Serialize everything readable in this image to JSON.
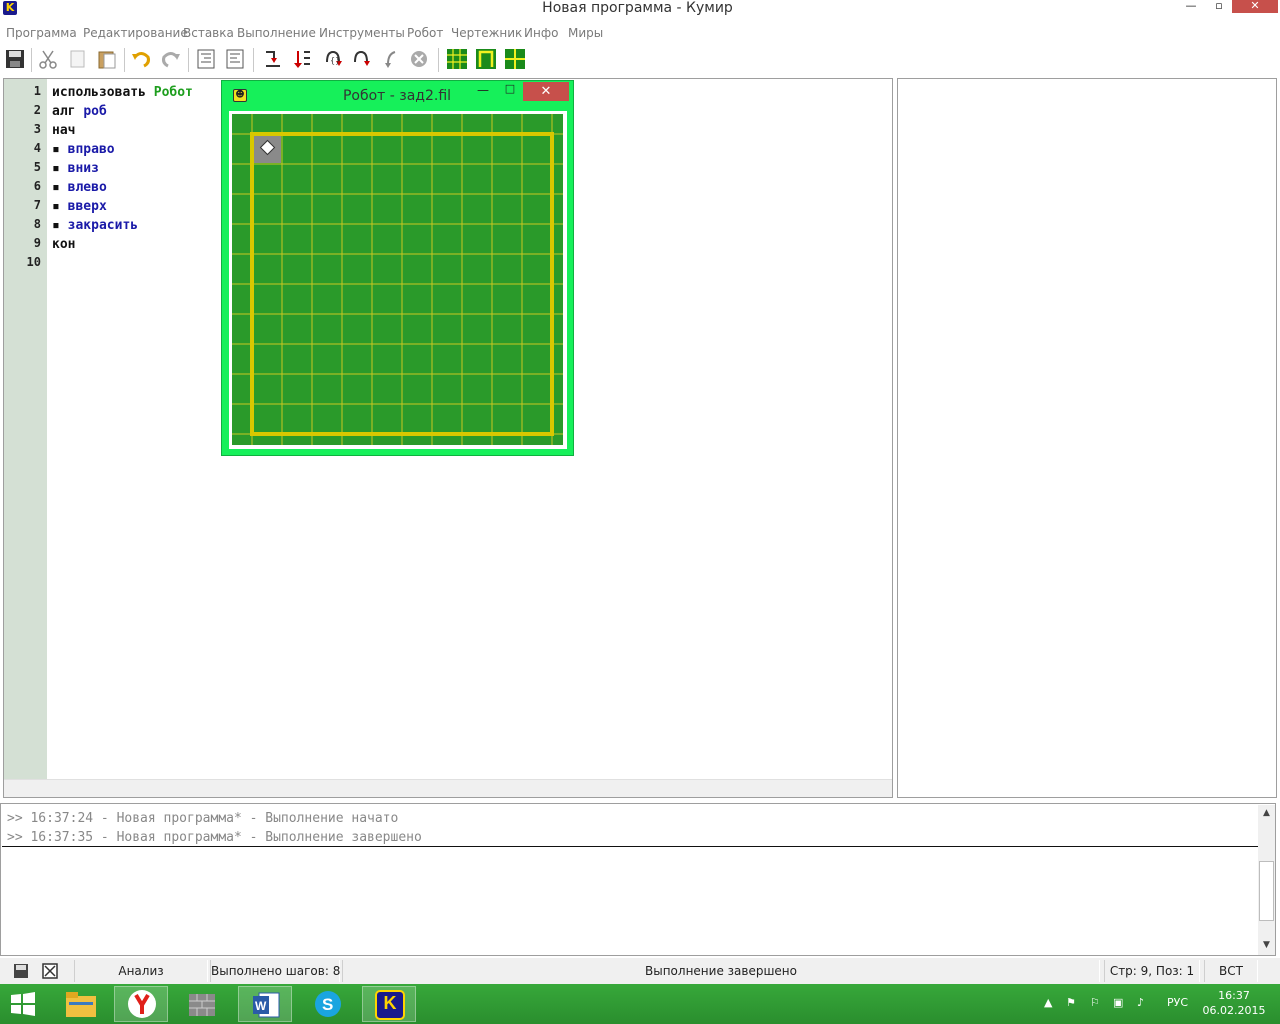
{
  "window": {
    "title": "Новая программа - Кумир",
    "app_icon_letter": "K"
  },
  "menu": [
    "Программа",
    "Редактирование",
    "Вставка",
    "Выполнение",
    "Инструменты",
    "Робот",
    "Чертежник",
    "Инфо",
    "Миры"
  ],
  "editor": {
    "line_numbers": [
      "1",
      "2",
      "3",
      "4",
      "5",
      "6",
      "7",
      "8",
      "9",
      "10"
    ],
    "lines": [
      {
        "kw": "использовать ",
        "mod": "Робот"
      },
      {
        "kw": "алг ",
        "ident": "роб"
      },
      {
        "kw": "нач"
      },
      {
        "dot": "▪ ",
        "ident": "вправо"
      },
      {
        "dot": "▪ ",
        "ident": "вниз"
      },
      {
        "dot": "▪ ",
        "ident": "влево"
      },
      {
        "dot": "▪ ",
        "ident": "вверх"
      },
      {
        "dot": "▪ ",
        "ident": "закрасить"
      },
      {
        "kw": "кон"
      }
    ]
  },
  "robot_window": {
    "title": "Робот - зад2.fil",
    "field_cells": 11,
    "robot_col": 0,
    "robot_row": 0
  },
  "output": {
    "lines": [
      ">> 16:37:24 - Новая программа* - Выполнение начато",
      ">> 16:37:35 - Новая программа* - Выполнение завершено"
    ]
  },
  "status": {
    "mode": "Анализ",
    "steps": "Выполнено шагов: 8",
    "message": "Выполнение завершено",
    "position": "Стр: 9, Поз: 1",
    "insert": "ВСТ"
  },
  "taskbar": {
    "lang": "РУС",
    "time": "16:37",
    "date": "06.02.2015",
    "kumir_letter": "K"
  },
  "colors": {
    "field_green": "#2a9a2a",
    "grid_yellow": "#c8c820",
    "robot_window_bg": "#16f05a",
    "keyword_blue": "#1a1aa8",
    "module_green": "#1e9e1e"
  }
}
